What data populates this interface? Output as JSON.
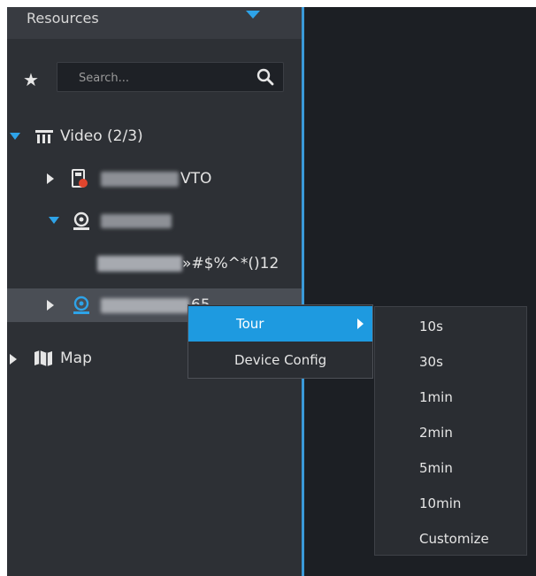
{
  "header": {
    "title": "Resources"
  },
  "search": {
    "placeholder": "Search..."
  },
  "tree": {
    "video": {
      "label": "Video (2/3)"
    },
    "vto": {
      "suffix": "VTO"
    },
    "channel": {
      "suffix": "»#$%^*()12"
    },
    "camera2": {
      "suffix": "65"
    },
    "map": {
      "label": "Map"
    }
  },
  "context_menu": {
    "items": [
      "Tour",
      "Device Config"
    ],
    "active": "Tour"
  },
  "tour_menu": {
    "items": [
      "10s",
      "30s",
      "1min",
      "2min",
      "5min",
      "10min",
      "Customize"
    ]
  },
  "colors": {
    "accent": "#1e9ae0",
    "splitter": "#3a9ad9",
    "panel": "#2d3035",
    "view": "#1c1f24"
  }
}
